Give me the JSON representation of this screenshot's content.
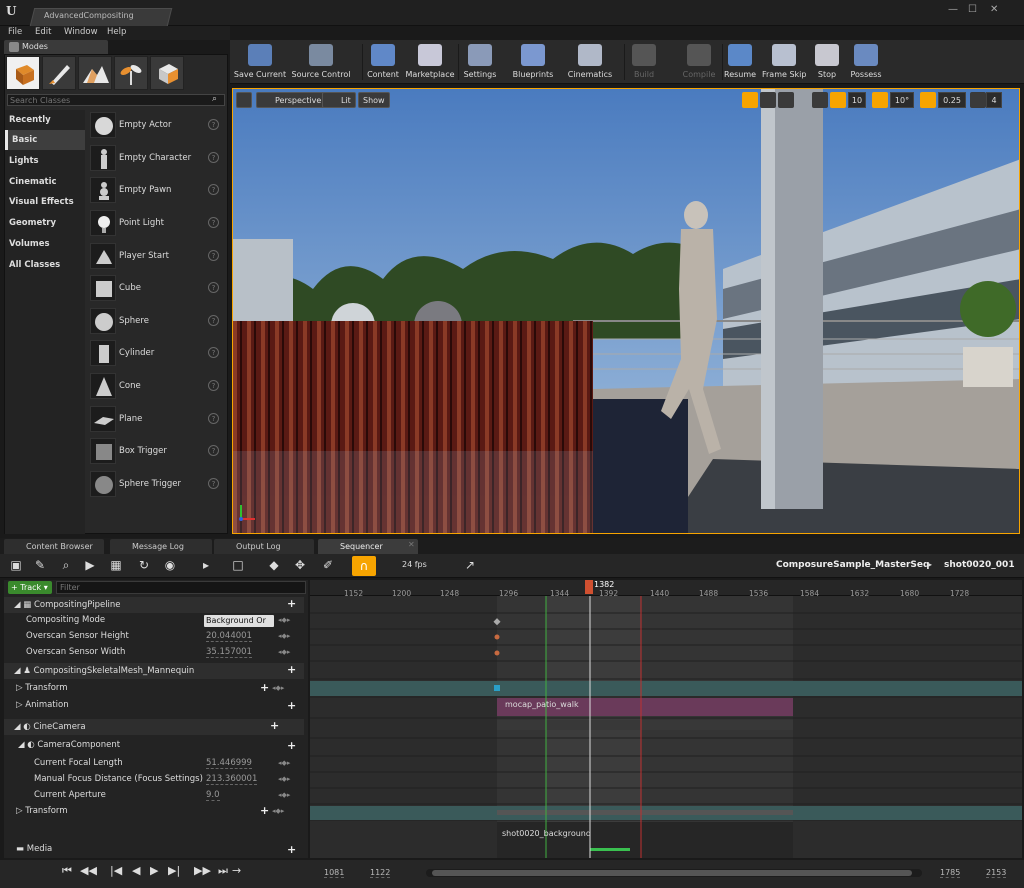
{
  "window": {
    "tab_title": "AdvancedCompositing"
  },
  "menu": [
    "File",
    "Edit",
    "Window",
    "Help"
  ],
  "modes": {
    "tab_label": "Modes",
    "search_placeholder": "Search Classes",
    "categories": [
      "Recently Placed",
      "Basic",
      "Lights",
      "Cinematic",
      "Visual Effects",
      "Geometry",
      "Volumes",
      "All Classes"
    ],
    "active_category": "Basic",
    "actors": [
      "Empty Actor",
      "Empty Character",
      "Empty Pawn",
      "Point Light",
      "Player Start",
      "Cube",
      "Sphere",
      "Cylinder",
      "Cone",
      "Plane",
      "Box Trigger",
      "Sphere Trigger"
    ]
  },
  "toolbar": [
    "Save Current",
    "Source Control",
    "Content",
    "Marketplace",
    "Settings",
    "Blueprints",
    "Cinematics",
    "Build",
    "Compile",
    "Resume",
    "Frame Skip",
    "Stop",
    "Possess"
  ],
  "viewport": {
    "perspective": "Perspective",
    "lit": "Lit",
    "show": "Show",
    "grid_snap": "10",
    "rot_snap": "10°",
    "scale_snap": "0.25",
    "cam_speed": "4"
  },
  "lower_tabs": [
    "Content Browser",
    "Message Log",
    "Output Log",
    "Sequencer"
  ],
  "sequencer": {
    "fps": "24 fps",
    "breadcrumb_root": "ComposureSample_MasterSeq",
    "breadcrumb_shot": "shot0020_001",
    "track_button": "Track",
    "filter_placeholder": "Filter",
    "playhead": "1382",
    "ticks": [
      "1152",
      "1200",
      "1248",
      "1296",
      "1344",
      "1392",
      "1440",
      "1488",
      "1536",
      "1584",
      "1632",
      "1680",
      "1728"
    ],
    "tracks": {
      "compositing_pipeline": "CompositingPipeline",
      "compositing_mode": "Compositing Mode",
      "compositing_mode_value": "Background Or",
      "overscan_height": "Overscan Sensor Height",
      "overscan_height_value": "20.044001",
      "overscan_width": "Overscan Sensor Width",
      "overscan_width_value": "35.157001",
      "mannequin": "CompositingSkeletalMesh_Mannequin",
      "transform": "Transform",
      "animation": "Animation",
      "cinecamera": "CineCamera",
      "camera_component": "CameraComponent",
      "focal_length": "Current Focal Length",
      "focal_length_value": "51.446999",
      "focus_distance": "Manual Focus Distance (Focus Settings)",
      "focus_distance_value": "213.360001",
      "aperture": "Current Aperture",
      "aperture_value": "9.0",
      "transform2": "Transform",
      "media": "Media"
    },
    "clip_anim": "mocap_patio_walk",
    "clip_media": "shot0020_background",
    "range_start": "1081",
    "range_in": "1122",
    "range_out": "1785",
    "range_end": "2153"
  }
}
